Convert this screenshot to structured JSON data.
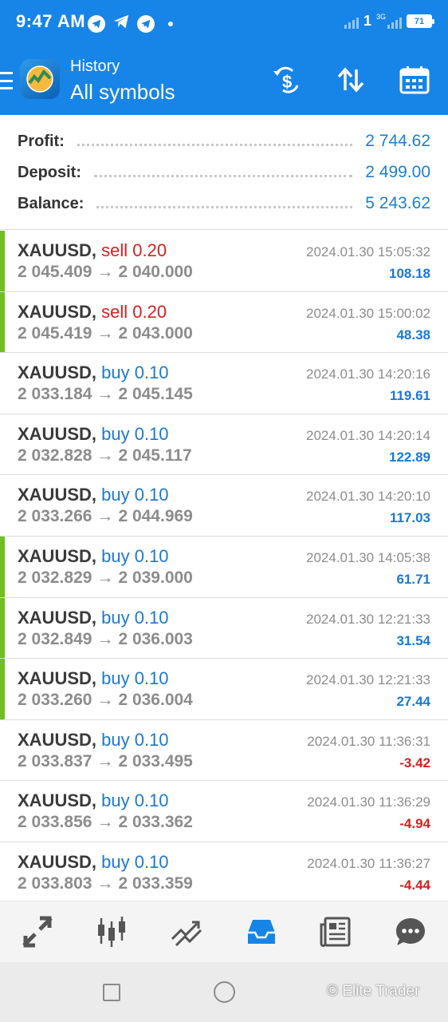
{
  "status_bar": {
    "time": "9:47 AM",
    "network": "3G",
    "battery": "71"
  },
  "toolbar": {
    "title_small": "History",
    "title_big": "All symbols"
  },
  "summary": {
    "profit_label": "Profit:",
    "profit_value": "2 744.62",
    "deposit_label": "Deposit:",
    "deposit_value": "2 499.00",
    "balance_label": "Balance:",
    "balance_value": "5 243.62"
  },
  "deals": [
    {
      "symbol": "XAUUSD,",
      "type": "sell 0.20",
      "open": "2 045.409",
      "arrow": "→",
      "close": "2 040.000",
      "time": "2024.01.30 15:05:32",
      "profit": "108.18",
      "side": "sell",
      "positive": true,
      "marker": true
    },
    {
      "symbol": "XAUUSD,",
      "type": "sell 0.20",
      "open": "2 045.419",
      "arrow": "→",
      "close": "2 043.000",
      "time": "2024.01.30 15:00:02",
      "profit": "48.38",
      "side": "sell",
      "positive": true,
      "marker": true
    },
    {
      "symbol": "XAUUSD,",
      "type": "buy 0.10",
      "open": "2 033.184",
      "arrow": "→",
      "close": "2 045.145",
      "time": "2024.01.30 14:20:16",
      "profit": "119.61",
      "side": "buy",
      "positive": true,
      "marker": false
    },
    {
      "symbol": "XAUUSD,",
      "type": "buy 0.10",
      "open": "2 032.828",
      "arrow": "→",
      "close": "2 045.117",
      "time": "2024.01.30 14:20:14",
      "profit": "122.89",
      "side": "buy",
      "positive": true,
      "marker": false
    },
    {
      "symbol": "XAUUSD,",
      "type": "buy 0.10",
      "open": "2 033.266",
      "arrow": "→",
      "close": "2 044.969",
      "time": "2024.01.30 14:20:10",
      "profit": "117.03",
      "side": "buy",
      "positive": true,
      "marker": false
    },
    {
      "symbol": "XAUUSD,",
      "type": "buy 0.10",
      "open": "2 032.829",
      "arrow": "→",
      "close": "2 039.000",
      "time": "2024.01.30 14:05:38",
      "profit": "61.71",
      "side": "buy",
      "positive": true,
      "marker": true
    },
    {
      "symbol": "XAUUSD,",
      "type": "buy 0.10",
      "open": "2 032.849",
      "arrow": "→",
      "close": "2 036.003",
      "time": "2024.01.30 12:21:33",
      "profit": "31.54",
      "side": "buy",
      "positive": true,
      "marker": true
    },
    {
      "symbol": "XAUUSD,",
      "type": "buy 0.10",
      "open": "2 033.260",
      "arrow": "→",
      "close": "2 036.004",
      "time": "2024.01.30 12:21:33",
      "profit": "27.44",
      "side": "buy",
      "positive": true,
      "marker": true
    },
    {
      "symbol": "XAUUSD,",
      "type": "buy 0.10",
      "open": "2 033.837",
      "arrow": "→",
      "close": "2 033.495",
      "time": "2024.01.30 11:36:31",
      "profit": "-3.42",
      "side": "buy",
      "positive": false,
      "marker": false
    },
    {
      "symbol": "XAUUSD,",
      "type": "buy 0.10",
      "open": "2 033.856",
      "arrow": "→",
      "close": "2 033.362",
      "time": "2024.01.30 11:36:29",
      "profit": "-4.94",
      "side": "buy",
      "positive": false,
      "marker": false
    },
    {
      "symbol": "XAUUSD,",
      "type": "buy 0.10",
      "open": "2 033.803",
      "arrow": "→",
      "close": "2 033.359",
      "time": "2024.01.30 11:36:27",
      "profit": "-4.44",
      "side": "buy",
      "positive": false,
      "marker": false
    }
  ],
  "bottom_nav": [
    {
      "icon": "quotes-icon",
      "active": false
    },
    {
      "icon": "chart-icon",
      "active": false
    },
    {
      "icon": "trade-icon",
      "active": false
    },
    {
      "icon": "history-icon",
      "active": true
    },
    {
      "icon": "news-icon",
      "active": false
    },
    {
      "icon": "chat-icon",
      "active": false
    }
  ],
  "watermark": "© Elite Trader",
  "colors": {
    "header_blue": "#1784e8",
    "profit_blue": "#1a78d2",
    "loss_red": "#d32020",
    "marker_green": "#6fbf1f",
    "active_nav": "#1784e8",
    "inactive_nav": "#555555"
  }
}
